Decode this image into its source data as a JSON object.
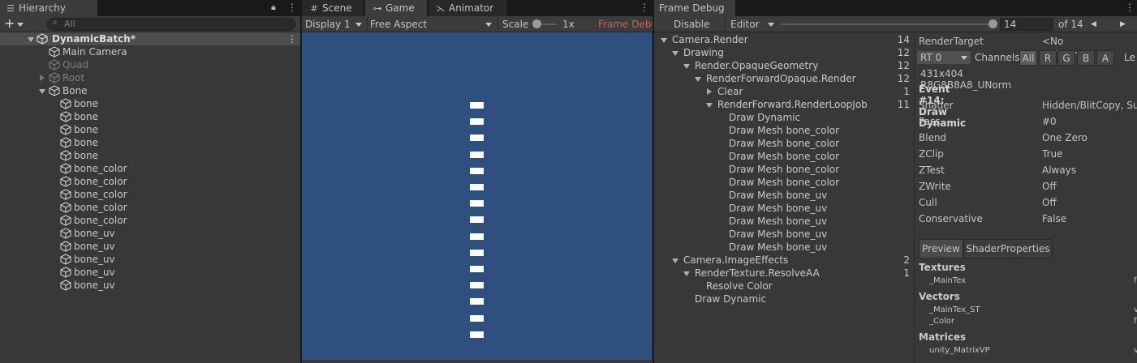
{
  "hierarchy": {
    "tab_label": "Hierarchy",
    "add_label": "+",
    "search_placeholder": "All",
    "scene_name": "DynamicBatch*",
    "items": [
      {
        "label": "Main Camera",
        "indent": 1,
        "state": "none",
        "dim": false
      },
      {
        "label": "Quad",
        "indent": 1,
        "state": "none",
        "dim": true
      },
      {
        "label": "Root",
        "indent": 1,
        "state": "collapsed",
        "dim": true
      },
      {
        "label": "Bone",
        "indent": 1,
        "state": "expanded",
        "dim": false
      },
      {
        "label": "bone",
        "indent": 2,
        "state": "none",
        "dim": false
      },
      {
        "label": "bone",
        "indent": 2,
        "state": "none",
        "dim": false
      },
      {
        "label": "bone",
        "indent": 2,
        "state": "none",
        "dim": false
      },
      {
        "label": "bone",
        "indent": 2,
        "state": "none",
        "dim": false
      },
      {
        "label": "bone",
        "indent": 2,
        "state": "none",
        "dim": false
      },
      {
        "label": "bone_color",
        "indent": 2,
        "state": "none",
        "dim": false
      },
      {
        "label": "bone_color",
        "indent": 2,
        "state": "none",
        "dim": false
      },
      {
        "label": "bone_color",
        "indent": 2,
        "state": "none",
        "dim": false
      },
      {
        "label": "bone_color",
        "indent": 2,
        "state": "none",
        "dim": false
      },
      {
        "label": "bone_color",
        "indent": 2,
        "state": "none",
        "dim": false
      },
      {
        "label": "bone_uv",
        "indent": 2,
        "state": "none",
        "dim": false
      },
      {
        "label": "bone_uv",
        "indent": 2,
        "state": "none",
        "dim": false
      },
      {
        "label": "bone_uv",
        "indent": 2,
        "state": "none",
        "dim": false
      },
      {
        "label": "bone_uv",
        "indent": 2,
        "state": "none",
        "dim": false
      },
      {
        "label": "bone_uv",
        "indent": 2,
        "state": "none",
        "dim": false
      }
    ]
  },
  "game": {
    "tabs": [
      {
        "label": "Scene",
        "icon": "grid-icon"
      },
      {
        "label": "Game",
        "icon": "gamepad-icon"
      },
      {
        "label": "Animator",
        "icon": "animator-icon"
      }
    ],
    "display": "Display 1",
    "aspect": "Free Aspect",
    "scale_label": "Scale",
    "scale_value": "1x",
    "frame_debug_label": "Frame Debu",
    "viewport_color": "#2f4f7f",
    "block_count": 15
  },
  "frame_debug": {
    "tab_label": "Frame Debug",
    "disable_label": "Disable",
    "editor_label": "Editor",
    "current_event": "14",
    "total_label": "of 14",
    "slider_fraction": 1.0,
    "tree": [
      {
        "label": "Camera.Render",
        "depth": 0,
        "arrow": "down",
        "count": "14"
      },
      {
        "label": "Drawing",
        "depth": 1,
        "arrow": "down",
        "count": "12"
      },
      {
        "label": "Render.OpaqueGeometry",
        "depth": 2,
        "arrow": "down",
        "count": "12"
      },
      {
        "label": "RenderForwardOpaque.Render",
        "depth": 3,
        "arrow": "down",
        "count": "12"
      },
      {
        "label": "Clear",
        "depth": 4,
        "arrow": "right",
        "count": "1"
      },
      {
        "label": "RenderForward.RenderLoopJob",
        "depth": 4,
        "arrow": "down",
        "count": "11"
      },
      {
        "label": "Draw Dynamic",
        "depth": 5,
        "arrow": "none",
        "count": ""
      },
      {
        "label": "Draw Mesh bone_color",
        "depth": 5,
        "arrow": "none",
        "count": ""
      },
      {
        "label": "Draw Mesh bone_color",
        "depth": 5,
        "arrow": "none",
        "count": ""
      },
      {
        "label": "Draw Mesh bone_color",
        "depth": 5,
        "arrow": "none",
        "count": ""
      },
      {
        "label": "Draw Mesh bone_color",
        "depth": 5,
        "arrow": "none",
        "count": ""
      },
      {
        "label": "Draw Mesh bone_color",
        "depth": 5,
        "arrow": "none",
        "count": ""
      },
      {
        "label": "Draw Mesh bone_uv",
        "depth": 5,
        "arrow": "none",
        "count": ""
      },
      {
        "label": "Draw Mesh bone_uv",
        "depth": 5,
        "arrow": "none",
        "count": ""
      },
      {
        "label": "Draw Mesh bone_uv",
        "depth": 5,
        "arrow": "none",
        "count": ""
      },
      {
        "label": "Draw Mesh bone_uv",
        "depth": 5,
        "arrow": "none",
        "count": ""
      },
      {
        "label": "Draw Mesh bone_uv",
        "depth": 5,
        "arrow": "none",
        "count": ""
      },
      {
        "label": "Camera.ImageEffects",
        "depth": 1,
        "arrow": "down",
        "count": "2"
      },
      {
        "label": "RenderTexture.ResolveAA",
        "depth": 2,
        "arrow": "down",
        "count": "1"
      },
      {
        "label": "Resolve Color",
        "depth": 3,
        "arrow": "none",
        "count": ""
      },
      {
        "label": "Draw Dynamic",
        "depth": 2,
        "arrow": "none",
        "count": ""
      }
    ],
    "render_target_label": "RenderTarget",
    "render_target_value": "<No name>",
    "rt_select": "RT 0",
    "channels_label": "Channels",
    "channels": [
      "All",
      "R",
      "G",
      "B",
      "A"
    ],
    "levels_label": "Le",
    "format": "431x404 R8G8B8A8_UNorm",
    "event_title": "Event #14: Draw Dynamic",
    "props": [
      {
        "name": "Shader",
        "value": "Hidden/BlitCopy, Sul"
      },
      {
        "name": "Pass",
        "value": "#0"
      },
      {
        "name": "Blend",
        "value": "One Zero"
      },
      {
        "name": "ZClip",
        "value": "True"
      },
      {
        "name": "ZTest",
        "value": "Always"
      },
      {
        "name": "ZWrite",
        "value": "Off"
      },
      {
        "name": "Cull",
        "value": "Off"
      },
      {
        "name": "Conservative",
        "value": "False"
      }
    ],
    "sub_tabs": [
      "Preview",
      "ShaderProperties"
    ],
    "sections": [
      {
        "title": "Textures",
        "items": [
          {
            "name": "_MainTex",
            "value": "f"
          }
        ]
      },
      {
        "title": "Vectors",
        "items": [
          {
            "name": "_MainTex_ST",
            "value": "v"
          },
          {
            "name": "_Color",
            "value": "f"
          }
        ]
      },
      {
        "title": "Matrices",
        "items": [
          {
            "name": "unity_MatrixVP",
            "value": "v"
          }
        ]
      }
    ]
  }
}
